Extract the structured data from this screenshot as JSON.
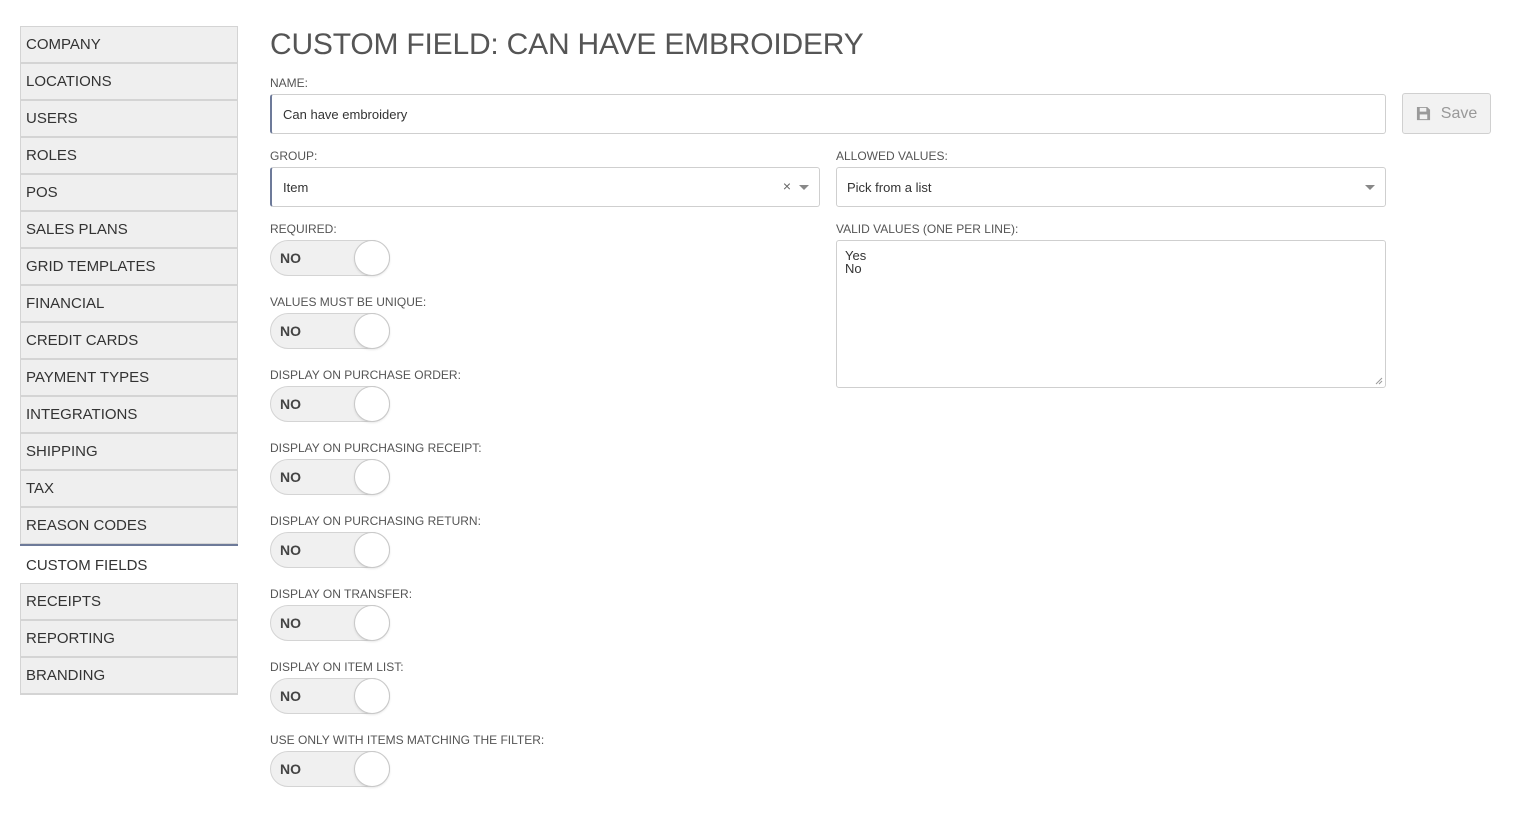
{
  "sidebar": {
    "items": [
      {
        "label": "COMPANY"
      },
      {
        "label": "LOCATIONS"
      },
      {
        "label": "USERS"
      },
      {
        "label": "ROLES"
      },
      {
        "label": "POS"
      },
      {
        "label": "SALES PLANS"
      },
      {
        "label": "GRID TEMPLATES"
      },
      {
        "label": "FINANCIAL"
      },
      {
        "label": "CREDIT CARDS"
      },
      {
        "label": "PAYMENT TYPES"
      },
      {
        "label": "INTEGRATIONS"
      },
      {
        "label": "SHIPPING"
      },
      {
        "label": "TAX"
      },
      {
        "label": "REASON CODES"
      },
      {
        "label": "CUSTOM FIELDS",
        "active": true
      },
      {
        "label": "RECEIPTS"
      },
      {
        "label": "REPORTING"
      },
      {
        "label": "BRANDING"
      }
    ]
  },
  "page": {
    "title": "CUSTOM FIELD: CAN HAVE EMBROIDERY",
    "save_label": "Save",
    "save_icon": "floppy-disk-icon"
  },
  "form": {
    "name": {
      "label": "NAME:",
      "value": "Can have embroidery"
    },
    "group": {
      "label": "GROUP:",
      "value": "Item",
      "clear_symbol": "×"
    },
    "allowed_values": {
      "label": "ALLOWED VALUES:",
      "value": "Pick from a list"
    },
    "valid_values": {
      "label": "VALID VALUES (ONE PER LINE):",
      "lines": [
        "Yes",
        "No"
      ]
    },
    "toggles": [
      {
        "label": "REQUIRED:",
        "value": "NO"
      },
      {
        "label": "VALUES MUST BE UNIQUE:",
        "value": "NO"
      },
      {
        "label": "DISPLAY ON PURCHASE ORDER:",
        "value": "NO"
      },
      {
        "label": "DISPLAY ON PURCHASING RECEIPT:",
        "value": "NO"
      },
      {
        "label": "DISPLAY ON PURCHASING RETURN:",
        "value": "NO"
      },
      {
        "label": "DISPLAY ON TRANSFER:",
        "value": "NO"
      },
      {
        "label": "DISPLAY ON ITEM LIST:",
        "value": "NO"
      },
      {
        "label": "USE ONLY WITH ITEMS MATCHING THE FILTER:",
        "value": "NO"
      }
    ]
  },
  "colors": {
    "accent": "#6d7a99",
    "sidebar_bg": "#efefef",
    "toggle_bg": "#f0f0f0"
  }
}
